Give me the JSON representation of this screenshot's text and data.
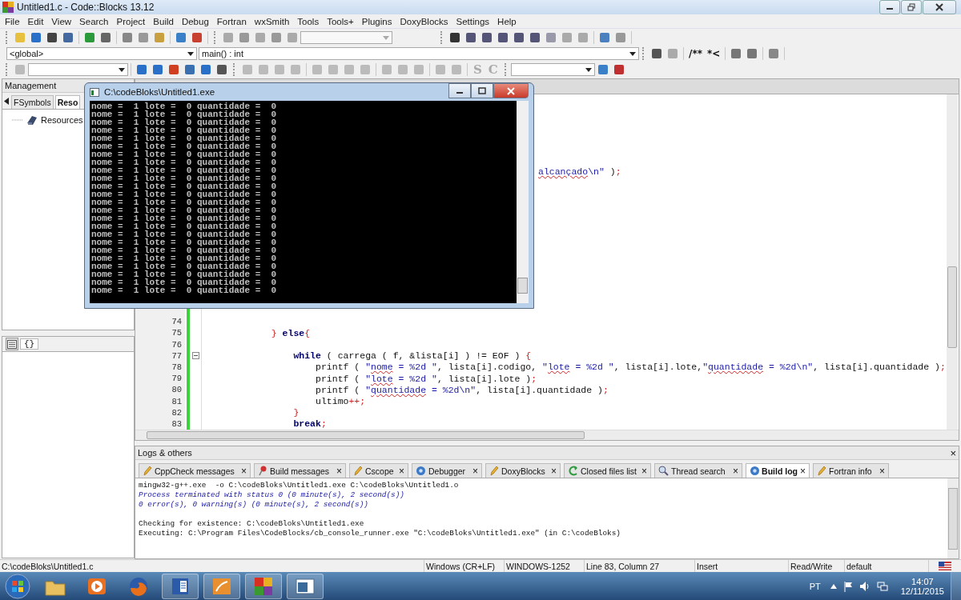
{
  "window": {
    "title": "Untitled1.c - Code::Blocks 13.12"
  },
  "menu": [
    "File",
    "Edit",
    "View",
    "Search",
    "Project",
    "Build",
    "Debug",
    "Fortran",
    "wxSmith",
    "Tools",
    "Tools+",
    "Plugins",
    "DoxyBlocks",
    "Settings",
    "Help"
  ],
  "toolbars": {
    "global_scope": "<global>",
    "function_scope": "main() : int",
    "comment_buttons": [
      "/**",
      "*<"
    ],
    "letter_buttons": [
      "S",
      "C"
    ]
  },
  "management": {
    "title": "Management",
    "tabs": [
      {
        "label": "FSymbols",
        "selected": false
      },
      {
        "label": "Reso",
        "selected": true
      }
    ],
    "tree": [
      {
        "label": "Resources"
      }
    ],
    "lower_tab": "{}"
  },
  "editor": {
    "fragment": [
      {
        "text": "alcançado",
        "kind": "spell"
      },
      {
        "text": "\\n\"",
        "kind": "str"
      },
      {
        "text": " )",
        "kind": "plain"
      },
      {
        "text": ";",
        "kind": "op"
      }
    ],
    "lines": [
      {
        "number": "74"
      },
      {
        "number": "75",
        "code": [
          {
            "text": "            }",
            "kind": "op"
          },
          {
            "text": " else",
            "kind": "kw"
          },
          {
            "text": "{",
            "kind": "op"
          }
        ]
      },
      {
        "number": "76"
      },
      {
        "number": "77",
        "code": [
          {
            "text": "                while",
            "kind": "kw"
          },
          {
            "text": " ( carrega ( f, &lista[i] ) != EOF ) ",
            "kind": "plain"
          },
          {
            "text": "{",
            "kind": "op"
          }
        ]
      },
      {
        "number": "78",
        "code": [
          {
            "text": "                    printf ( ",
            "kind": "plain"
          },
          {
            "text": "\"",
            "kind": "str"
          },
          {
            "text": "nome",
            "kind": "spell"
          },
          {
            "text": " = %2d \"",
            "kind": "str"
          },
          {
            "text": ", lista[i].codigo, ",
            "kind": "plain"
          },
          {
            "text": "\"",
            "kind": "str"
          },
          {
            "text": "lote",
            "kind": "spell"
          },
          {
            "text": " = %2d \"",
            "kind": "str"
          },
          {
            "text": ", lista[i].lote,",
            "kind": "plain"
          },
          {
            "text": "\"",
            "kind": "str"
          },
          {
            "text": "quantidade",
            "kind": "spell"
          },
          {
            "text": " = %2d\\n\"",
            "kind": "str"
          },
          {
            "text": ", lista[i].quantidade )",
            "kind": "plain"
          },
          {
            "text": ";",
            "kind": "op"
          }
        ]
      },
      {
        "number": "79",
        "code": [
          {
            "text": "                    printf ( ",
            "kind": "plain"
          },
          {
            "text": "\"",
            "kind": "str"
          },
          {
            "text": "lote",
            "kind": "spell"
          },
          {
            "text": " = %2d \"",
            "kind": "str"
          },
          {
            "text": ", lista[i].lote )",
            "kind": "plain"
          },
          {
            "text": ";",
            "kind": "op"
          }
        ]
      },
      {
        "number": "80",
        "code": [
          {
            "text": "                    printf ( ",
            "kind": "plain"
          },
          {
            "text": "\"",
            "kind": "str"
          },
          {
            "text": "quantidade",
            "kind": "spell"
          },
          {
            "text": " = %2d\\n\"",
            "kind": "str"
          },
          {
            "text": ", lista[i].quantidade )",
            "kind": "plain"
          },
          {
            "text": ";",
            "kind": "op"
          }
        ]
      },
      {
        "number": "81",
        "code": [
          {
            "text": "                    ultimo",
            "kind": "plain"
          },
          {
            "text": "++;",
            "kind": "op"
          }
        ]
      },
      {
        "number": "82",
        "code": [
          {
            "text": "                }",
            "kind": "op"
          }
        ]
      },
      {
        "number": "83",
        "code": [
          {
            "text": "                break",
            "kind": "kw"
          },
          {
            "text": ";",
            "kind": "op"
          }
        ]
      }
    ]
  },
  "console": {
    "title": "C:\\codeBloks\\Untitled1.exe",
    "lines": [
      "nome =  1 lote =  0 quantidade =  0",
      "nome =  1 lote =  0 quantidade =  0",
      "nome =  1 lote =  0 quantidade =  0",
      "nome =  1 lote =  0 quantidade =  0",
      "nome =  1 lote =  0 quantidade =  0",
      "nome =  1 lote =  0 quantidade =  0",
      "nome =  1 lote =  0 quantidade =  0",
      "nome =  1 lote =  0 quantidade =  0",
      "nome =  1 lote =  0 quantidade =  0",
      "nome =  1 lote =  0 quantidade =  0",
      "nome =  1 lote =  0 quantidade =  0",
      "nome =  1 lote =  0 quantidade =  0",
      "nome =  1 lote =  0 quantidade =  0",
      "nome =  1 lote =  0 quantidade =  0",
      "nome =  1 lote =  0 quantidade =  0",
      "nome =  1 lote =  0 quantidade =  0",
      "nome =  1 lote =  0 quantidade =  0",
      "nome =  1 lote =  0 quantidade =  0",
      "nome =  1 lote =  0 quantidade =  0",
      "nome =  1 lote =  0 quantidade =  0",
      "nome =  1 lote =  0 quantidade =  0",
      "nome =  1 lote =  0 quantidade =  0",
      "nome =  1 lote =  0 quantidade =  0",
      "nome =  1 lote =  0 quantidade =  0"
    ]
  },
  "logs": {
    "title": "Logs & others",
    "close": "×",
    "tabs": [
      {
        "label": "CppCheck messages",
        "kind": "pencil",
        "close": "×",
        "selected": false
      },
      {
        "label": "Build messages",
        "kind": "pin",
        "close": "×",
        "selected": false
      },
      {
        "label": "Cscope",
        "kind": "pencil",
        "close": "×",
        "selected": false
      },
      {
        "label": "Debugger",
        "kind": "cog",
        "close": "×",
        "selected": false
      },
      {
        "label": "DoxyBlocks",
        "kind": "pencil",
        "close": "×",
        "selected": false
      },
      {
        "label": "Closed files list",
        "kind": "arrow",
        "close": "×",
        "selected": false
      },
      {
        "label": "Thread search",
        "kind": "search",
        "close": "×",
        "selected": false
      },
      {
        "label": "Build log",
        "kind": "cog",
        "close": "×",
        "selected": true
      },
      {
        "label": "Fortran info",
        "kind": "pencil",
        "close": "×",
        "selected": false
      }
    ],
    "blocks": [
      [
        {
          "kind": "plain",
          "text": "mingw32-g++.exe  -o C:\\codeBloks\\Untitled1.exe C:\\codeBloks\\Untitled1.o"
        },
        {
          "kind": "info",
          "text": "Process terminated with status 0 (0 minute(s), 2 second(s))"
        },
        {
          "kind": "info",
          "text": "0 error(s), 0 warning(s) (0 minute(s), 2 second(s))"
        }
      ],
      [
        {
          "kind": "plain",
          "text": "Checking for existence: C:\\codeBloks\\Untitled1.exe"
        },
        {
          "kind": "plain",
          "text": "Executing: C:\\Program Files\\CodeBlocks/cb_console_runner.exe \"C:\\codeBloks\\Untitled1.exe\" (in C:\\codeBloks)"
        }
      ]
    ]
  },
  "status_bar": [
    "C:\\codeBloks\\Untitled1.c",
    "Windows (CR+LF)",
    "WINDOWS-1252",
    "Line 83, Column 27",
    "Insert",
    "Read/Write",
    "default"
  ],
  "taskbar": {
    "language": "PT",
    "time": "14:07",
    "date": "12/11/2015"
  }
}
